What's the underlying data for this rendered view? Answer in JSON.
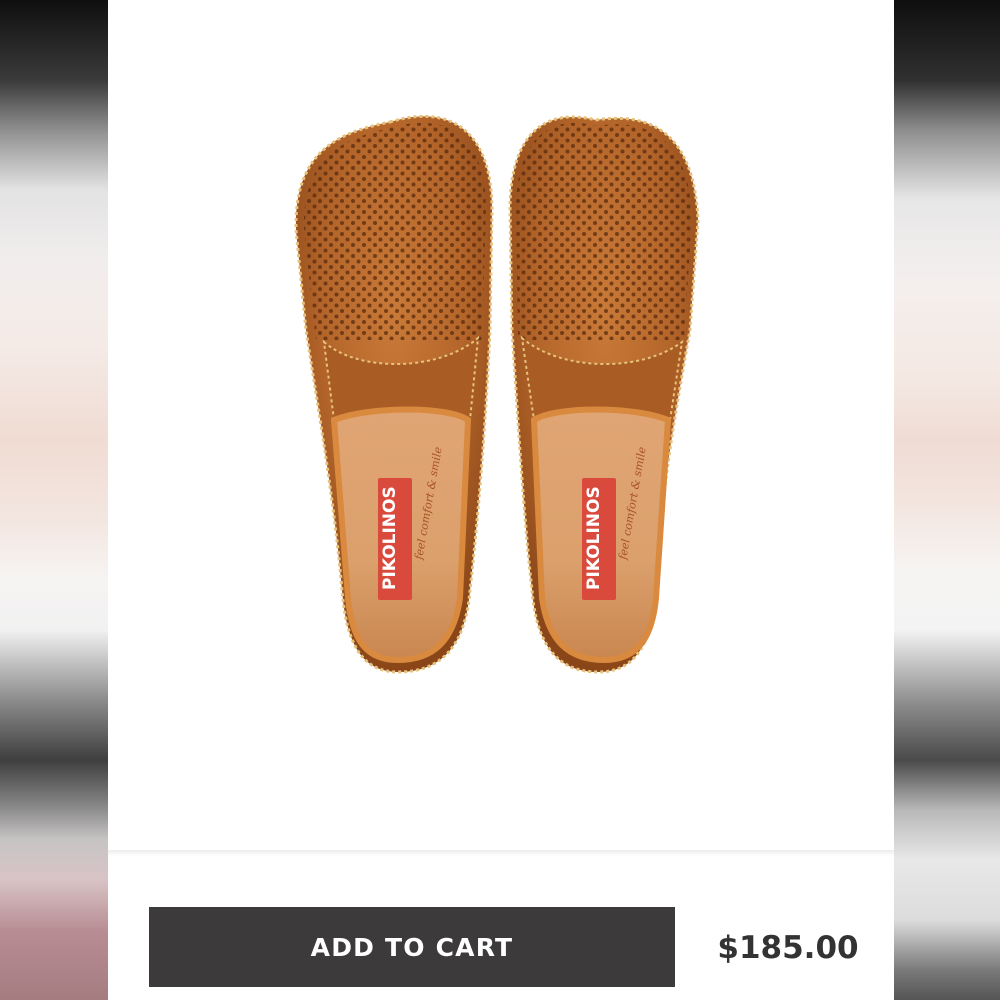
{
  "product": {
    "image_alt": "Pikolinos perforated leather loafers",
    "insole_brand": "PIKOLINOS",
    "insole_tagline": "feel comfort & smile"
  },
  "cart": {
    "add_to_cart_label": "ADD TO CART",
    "price": "$185.00"
  },
  "colors": {
    "button_bg": "#3d3a3b",
    "leather": "#b8682a",
    "insole_logo": "#d94a3d"
  }
}
